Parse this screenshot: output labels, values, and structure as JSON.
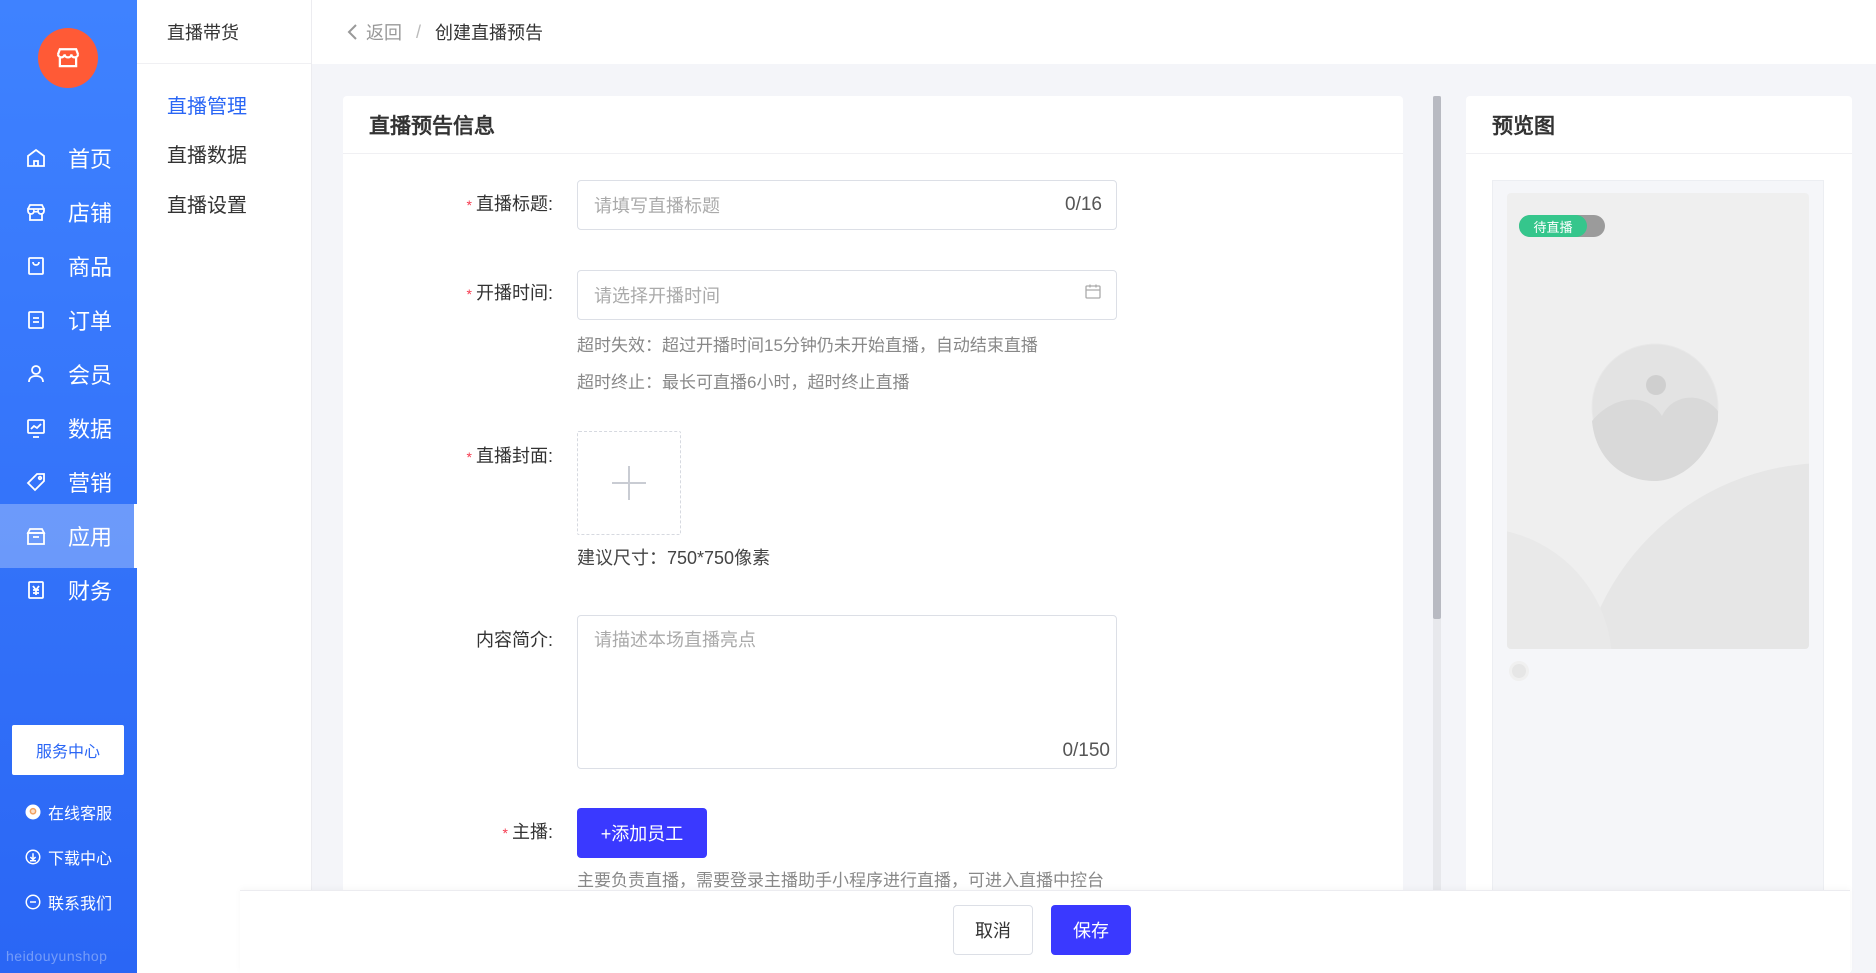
{
  "nav": {
    "items": [
      {
        "label": "首页",
        "icon": "home-icon"
      },
      {
        "label": "店铺",
        "icon": "store-icon"
      },
      {
        "label": "商品",
        "icon": "goods-icon"
      },
      {
        "label": "订单",
        "icon": "order-icon"
      },
      {
        "label": "会员",
        "icon": "member-icon"
      },
      {
        "label": "数据",
        "icon": "chart-icon"
      },
      {
        "label": "营销",
        "icon": "tag-icon"
      },
      {
        "label": "应用",
        "icon": "app-icon"
      },
      {
        "label": "财务",
        "icon": "finance-icon"
      }
    ],
    "active_label": "应用",
    "service_label": "服务中心",
    "links": [
      {
        "label": "在线客服",
        "icon": "customer-service-icon"
      },
      {
        "label": "下载中心",
        "icon": "download-icon"
      },
      {
        "label": "联系我们",
        "icon": "chat-icon"
      }
    ],
    "brand": "heidouyunshop",
    "accent": "#2a66f5"
  },
  "subnav": {
    "header": "直播带货",
    "items": [
      "直播管理",
      "直播数据",
      "直播设置"
    ],
    "active": "直播管理"
  },
  "breadcrumb": {
    "back": "返回",
    "separator": "/",
    "current": "创建直播预告"
  },
  "form": {
    "title": "直播预告信息",
    "fields": {
      "title": {
        "label": "直播标题:",
        "placeholder": "请填写直播标题",
        "counter": "0/16"
      },
      "time": {
        "label": "开播时间:",
        "placeholder": "请选择开播时间",
        "hints": [
          "超时失效：超过开播时间15分钟仍未开始直播，自动结束直播",
          "超时终止：最长可直播6小时，超时终止直播"
        ]
      },
      "cover": {
        "label": "直播封面:",
        "hint": "建议尺寸：750*750像素"
      },
      "intro": {
        "label": "内容简介:",
        "placeholder": "请描述本场直播亮点",
        "counter": "0/150"
      },
      "anchor": {
        "label": "主播:",
        "button": "+添加员工",
        "hint": "主要负责直播，需要登录主播助手小程序进行直播，可进入直播中控台"
      }
    }
  },
  "preview": {
    "title": "预览图",
    "badge": "待直播"
  },
  "actions": {
    "cancel": "取消",
    "save": "保存",
    "primary_color": "#3a39ff"
  }
}
